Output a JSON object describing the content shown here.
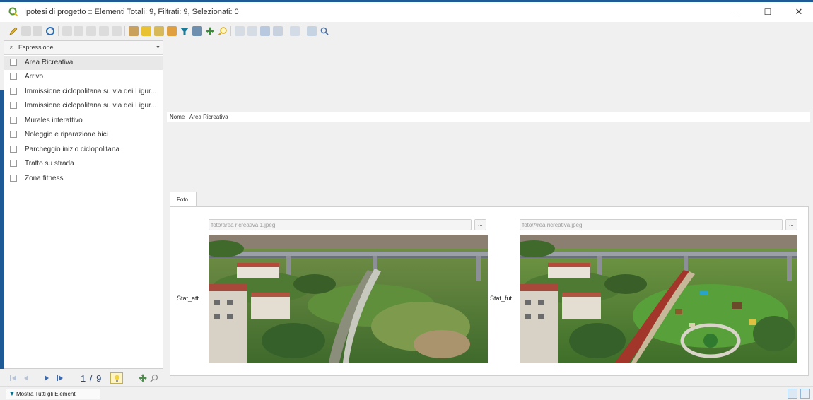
{
  "window": {
    "title": "Ipotesi di progetto :: Elementi Totali: 9, Filtrati: 9, Selezionati: 0",
    "minimize": "–",
    "maximize": "☐",
    "close": "✕"
  },
  "left_panel": {
    "expression_label": "Espressione",
    "expression_icon": "ε",
    "features": [
      {
        "label": "Area Ricreativa",
        "selected": true
      },
      {
        "label": "Arrivo"
      },
      {
        "label": "Immissione ciclopolitana su via dei Ligur..."
      },
      {
        "label": "Immissione ciclopolitana su via dei Ligur..."
      },
      {
        "label": "Murales interattivo"
      },
      {
        "label": "Noleggio e riparazione bici"
      },
      {
        "label": "Parcheggio inizio ciclopolitana"
      },
      {
        "label": "Tratto su strada"
      },
      {
        "label": "Zona fitness"
      }
    ],
    "navigation": {
      "counter": "1 / 9"
    }
  },
  "status_bar": {
    "filter_label": "Mostra Tutti gli Elementi"
  },
  "form": {
    "nome_label": "Nome",
    "nome_value": "Area Ricreativa",
    "tab_label": "Foto",
    "photo_left": {
      "label": "Stat_att",
      "path": "foto/area ricreativa 1.jpeg",
      "button": "..."
    },
    "photo_right": {
      "label": "Stat_fut",
      "path": "foto/Area ricreativa.jpeg",
      "button": "..."
    }
  },
  "colors": {
    "accent": "#1e5a96",
    "selection": "#e8e8e8"
  }
}
